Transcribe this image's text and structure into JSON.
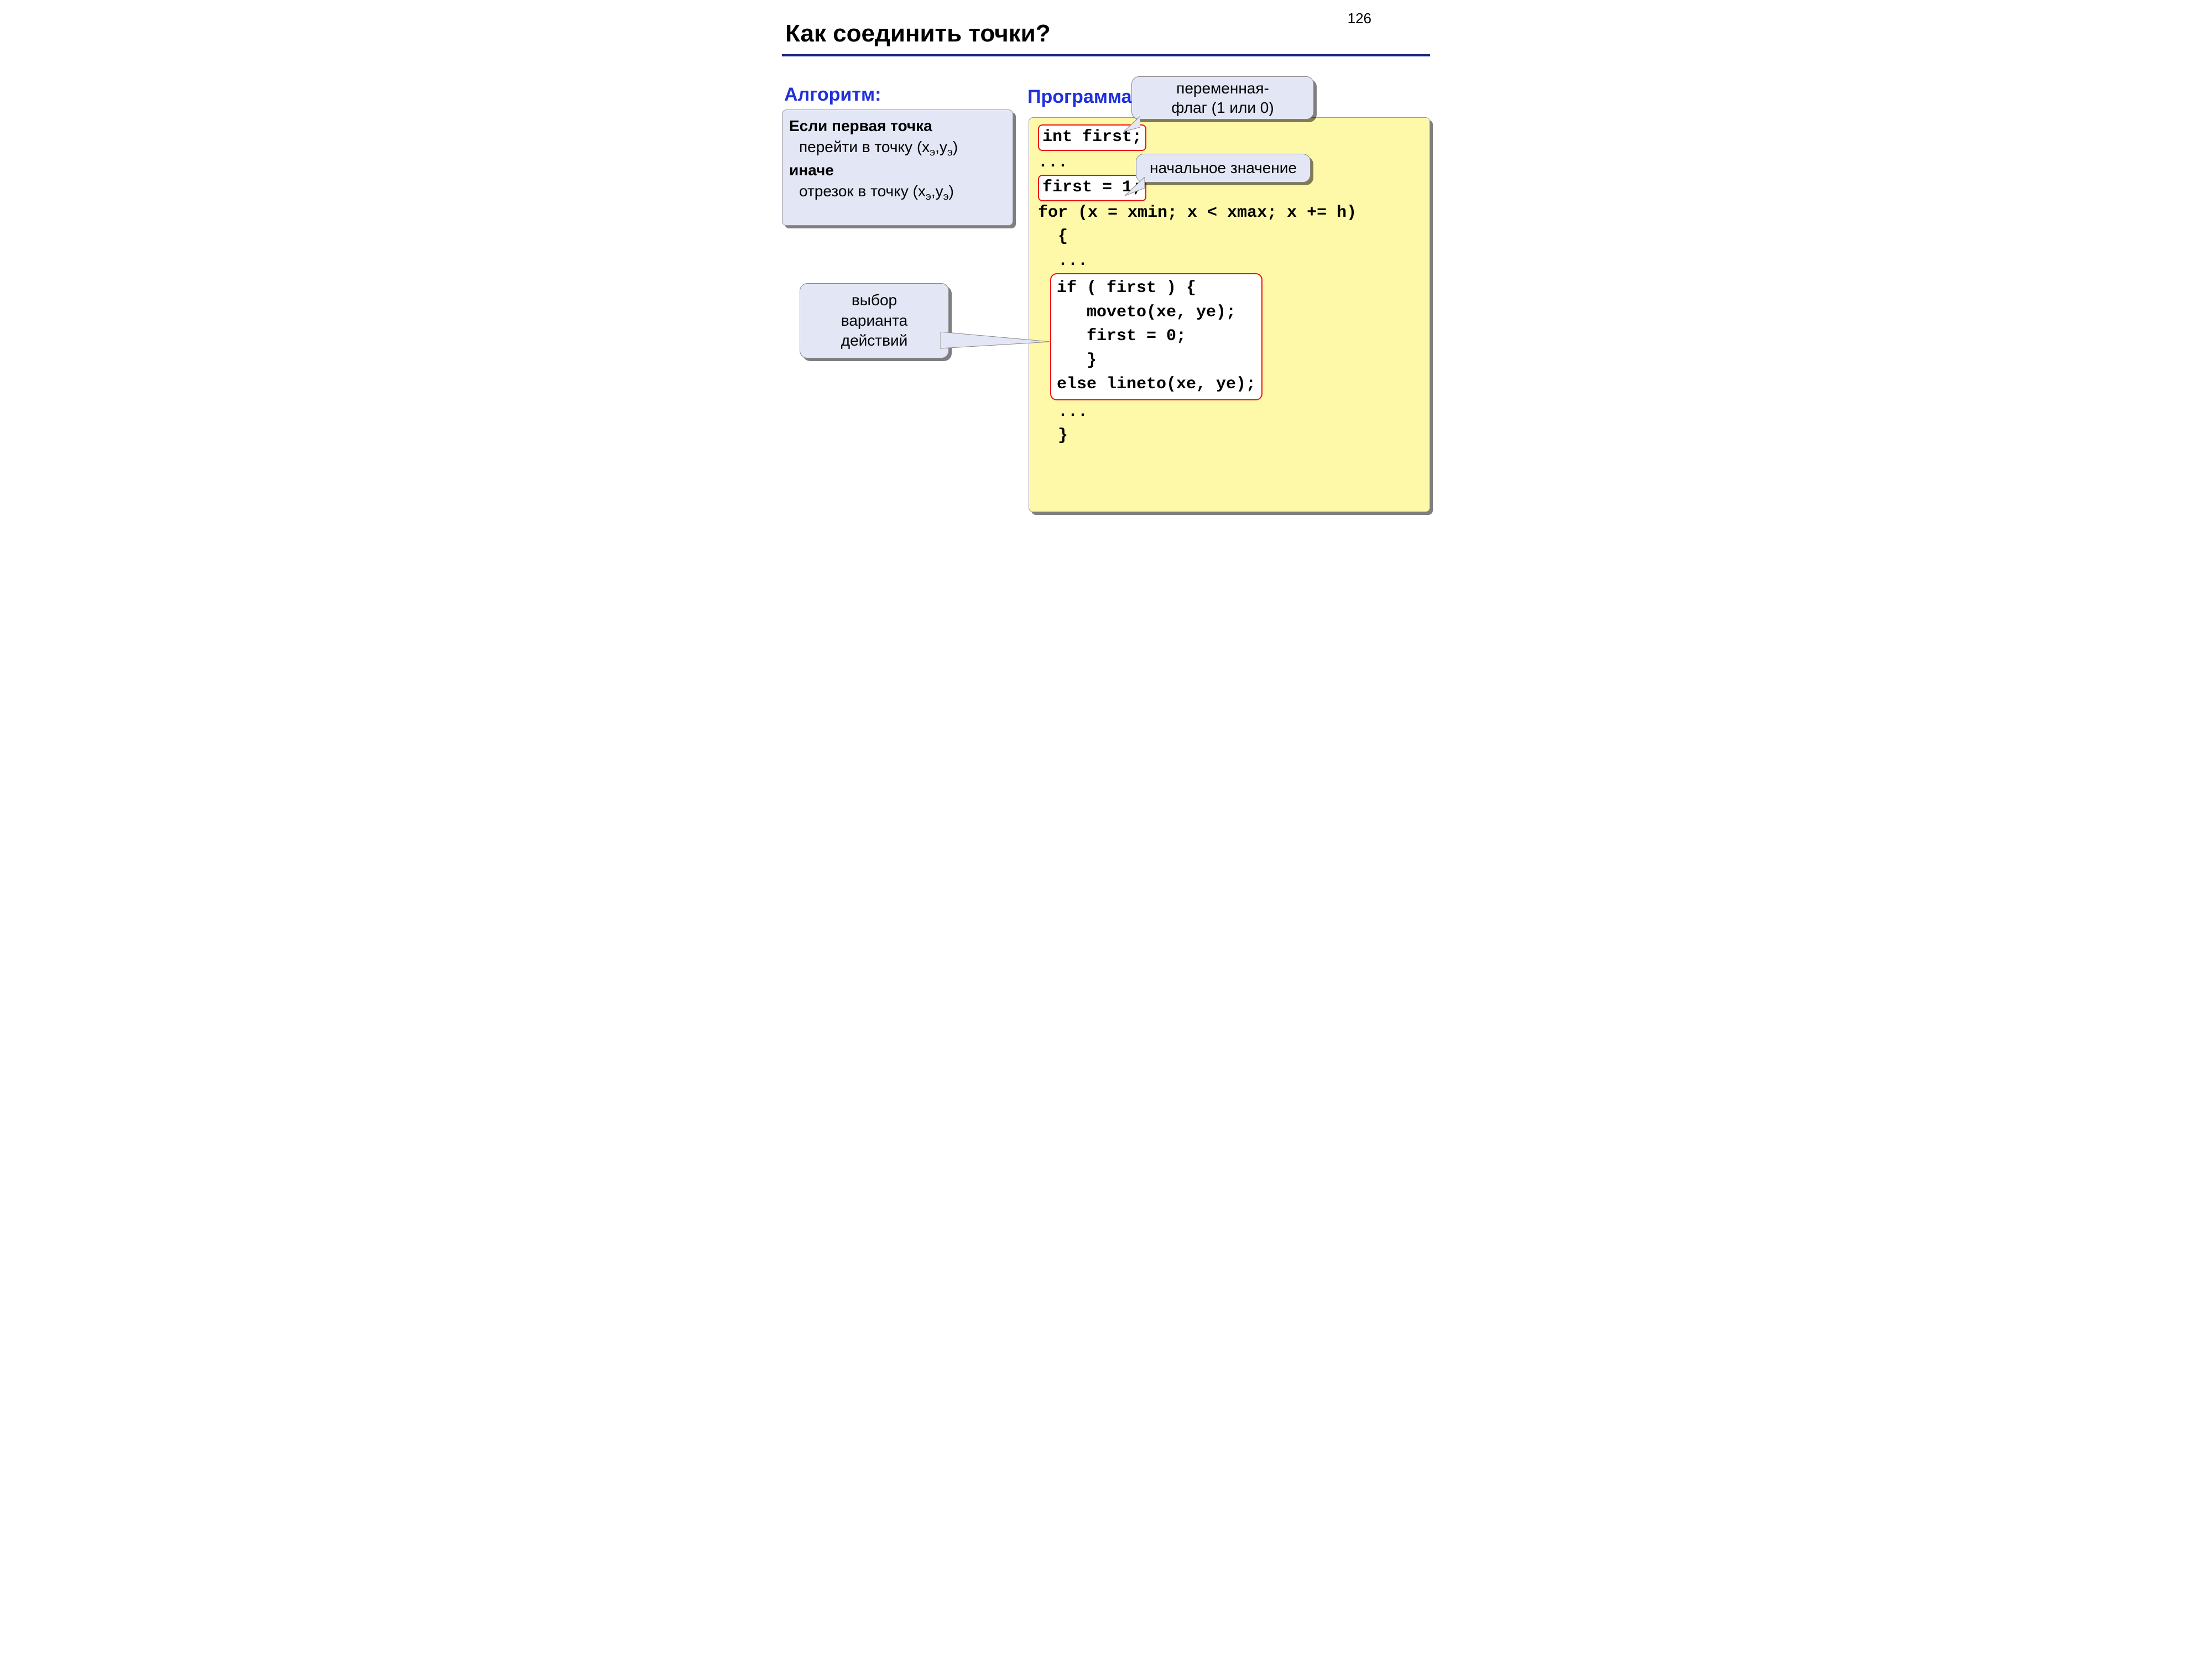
{
  "page_number": "126",
  "title": "Как соединить точки?",
  "heading_algo": "Алгоритм:",
  "heading_prog": "Программа:",
  "algo": {
    "l1_bold": "Если первая точка",
    "l2_prefix": "перейти в точку (x",
    "l2_sub1": "э",
    "l2_mid": ",y",
    "l2_sub2": "э",
    "l2_end": ")",
    "l3_bold": "иначе",
    "l4_prefix": "отрезок в точку (x",
    "l4_sub1": "э",
    "l4_mid": ",y",
    "l4_sub2": "э",
    "l4_end": ")"
  },
  "code": {
    "l1": "int first;",
    "l2": "...",
    "l3": "first = 1;",
    "l4": "for (x = xmin;  x < xmax;  x += h)",
    "l5": "  {",
    "l6": "  ...",
    "b1": "if ( first ) {",
    "b2": "   moveto(xe, ye);",
    "b3": "   first = 0;",
    "b4": "   }",
    "b5": "else lineto(xe, ye);",
    "l7": "  ...",
    "l8": "  }"
  },
  "callouts": {
    "flag_l1": "переменная-",
    "flag_l2": "флаг (1 или 0)",
    "init": "начальное значение",
    "choice_l1": "выбор",
    "choice_l2": "варианта",
    "choice_l3": "действий"
  }
}
